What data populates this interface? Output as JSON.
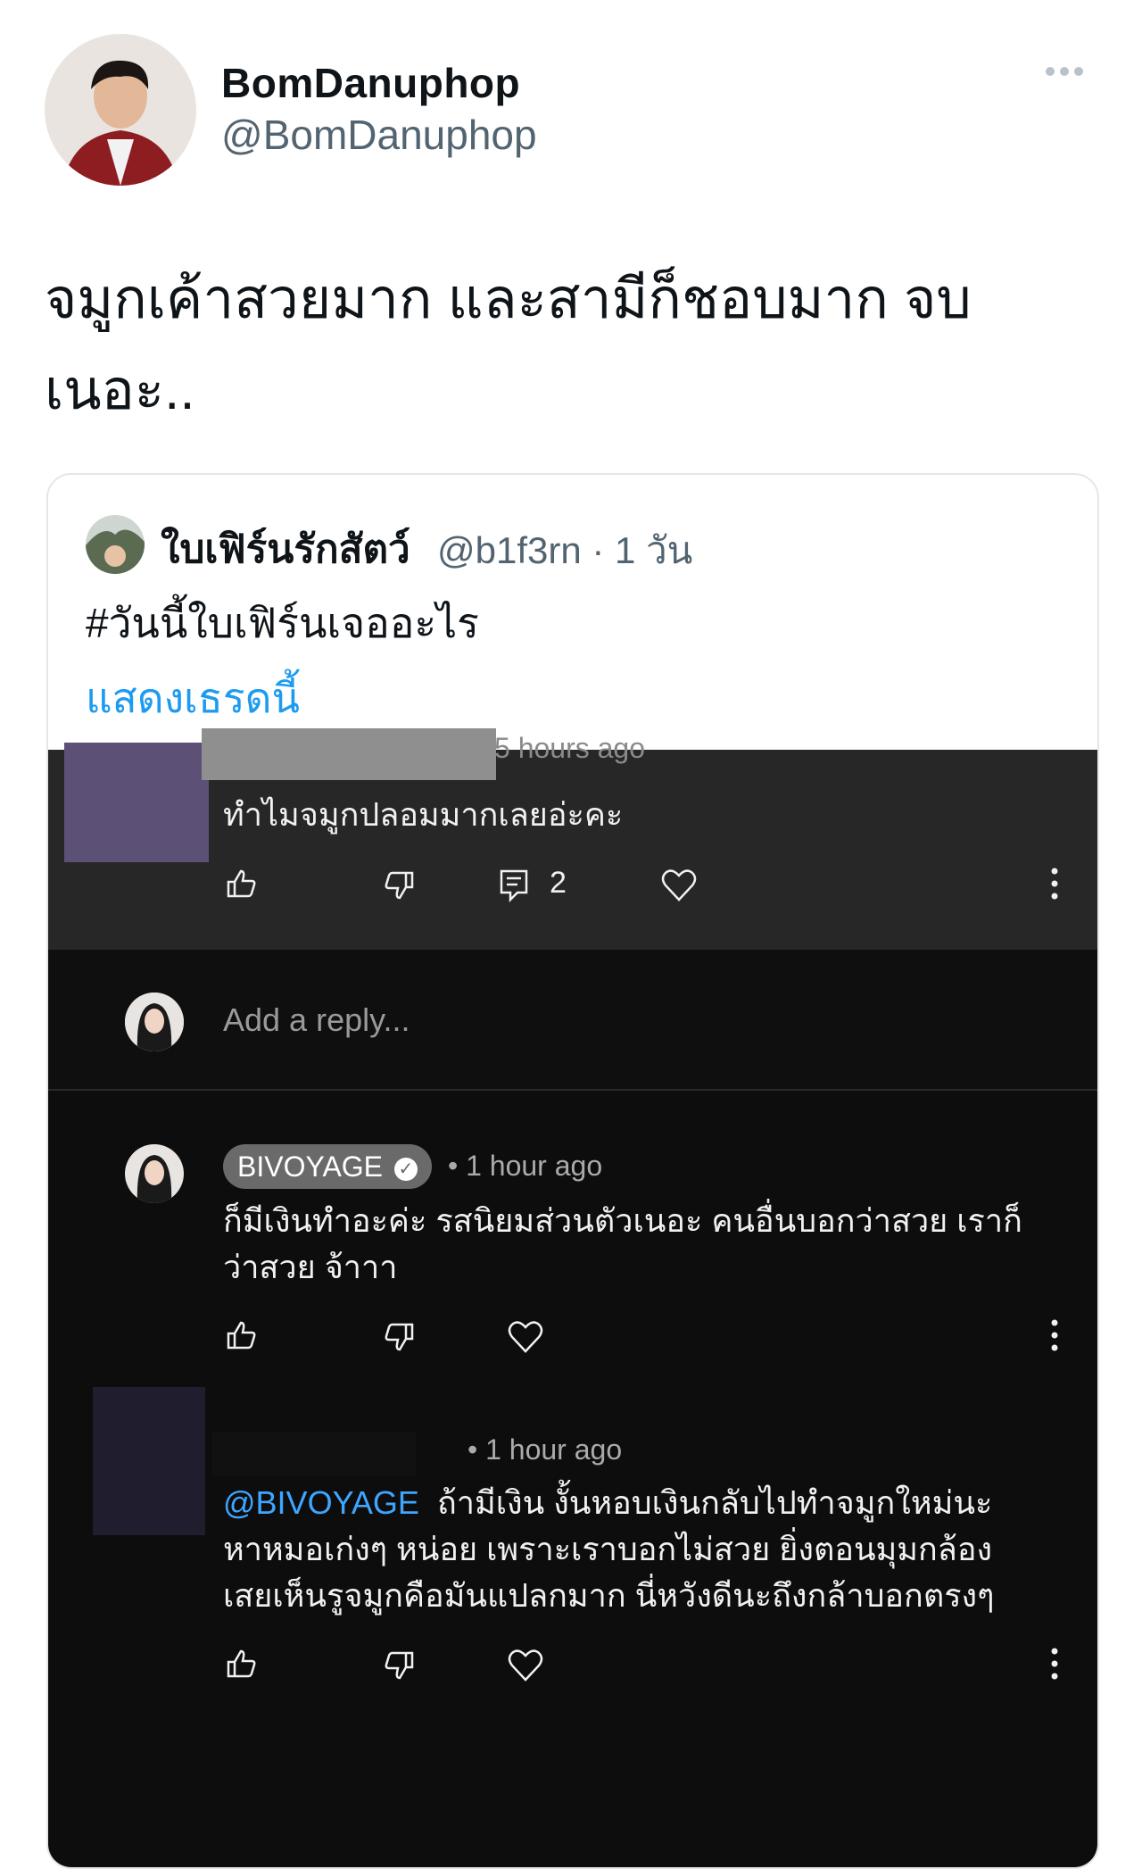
{
  "tweet": {
    "display_name": "BomDanuphop",
    "handle": "@BomDanuphop",
    "text_line1": "จมูกเค้าสวยมาก และสามีก็ชอบมาก จบ",
    "text_line2": "เนอะ.."
  },
  "quoted": {
    "name": "ใบเฟิร์นรักสัตว์",
    "handle_time": "@b1f3rn · 1 วัน",
    "text": "#วันนี้ใบเฟิร์นเจออะไร",
    "show_thread": "แสดงเธรดนี้"
  },
  "screenshot": {
    "comment1": {
      "time": "5 hours ago",
      "text": "ทำไมจมูกปลอมมากเลยอ่ะคะ",
      "reply_count": "2"
    },
    "reply_placeholder": "Add a reply...",
    "comment2": {
      "author": "BIVOYAGE",
      "time": "• 1 hour ago",
      "line1": "ก็มีเงินทำอะค่ะ รสนิยมส่วนตัวเนอะ คนอื่นบอกว่าสวย เราก็",
      "line2": "ว่าสวย จ้าาา"
    },
    "comment3": {
      "time": "• 1 hour ago",
      "mention": "@BIVOYAGE",
      "line1": "ถ้ามีเงิน งั้นหอบเงินกลับไปทำจมูกใหม่นะ",
      "line2": "หาหมอเก่งๆ หน่อย เพราะเราบอกไม่สวย ยิ่งตอนมุมกล้อง",
      "line3": "เสยเห็นรูจมูกคือมันแปลกมาก นี่หวังดีนะถึงกล้าบอกตรงๆ"
    }
  },
  "colors": {
    "link_blue": "#1d9bf0",
    "dark_bg": "#0d0d0d",
    "mention_blue": "#3ea6ff"
  }
}
